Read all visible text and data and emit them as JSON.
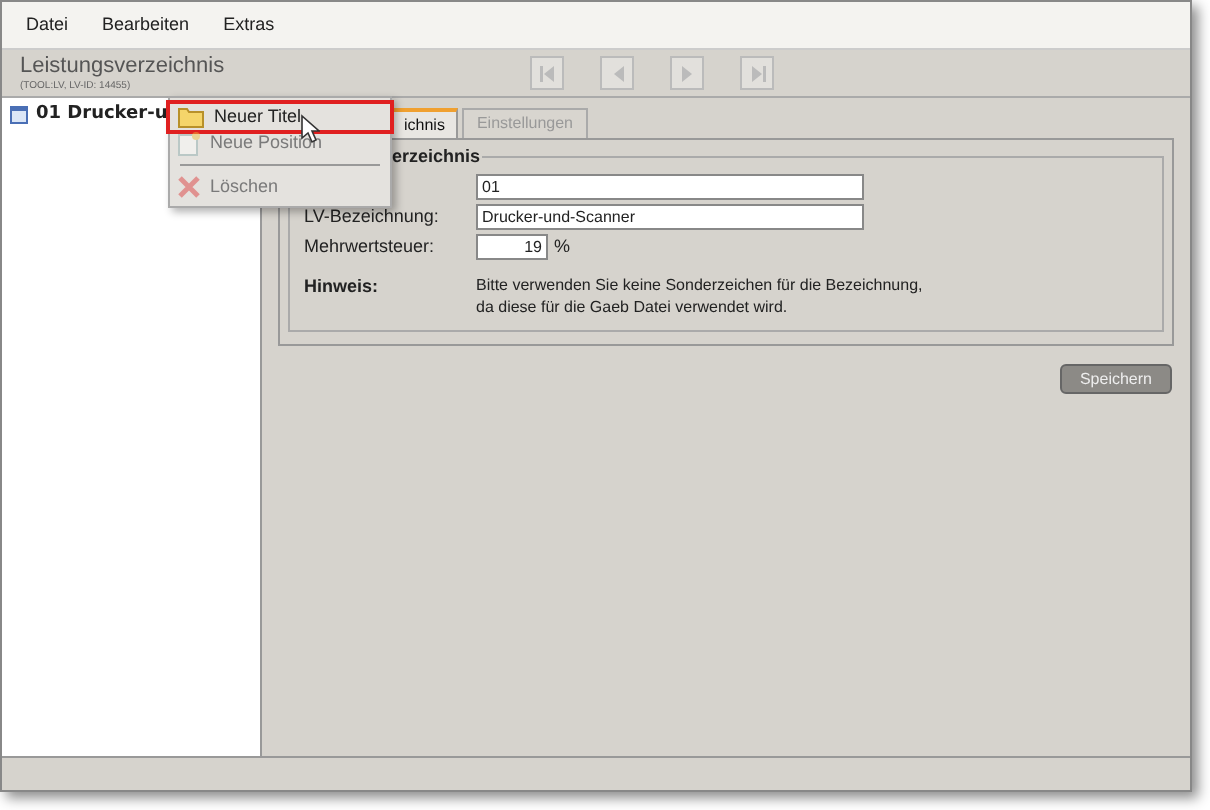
{
  "menu_bar": [
    "Datei",
    "Bearbeiten",
    "Extras"
  ],
  "header": {
    "title": "Leistungsverzeichnis",
    "subtitle": "(TOOL:LV, LV-ID: 14455)"
  },
  "nav_buttons": [
    {
      "kind": "first",
      "disabled": true
    },
    {
      "kind": "prev",
      "disabled": true
    },
    {
      "kind": "next",
      "disabled": true
    },
    {
      "kind": "last",
      "disabled": true
    }
  ],
  "tree": [
    {
      "label": "01 Drucker-u"
    }
  ],
  "context_menu": [
    {
      "kind": "new-title",
      "label": "Neuer Titel",
      "disabled": false,
      "highlighted": true
    },
    {
      "kind": "new-position",
      "label": "Neue Position",
      "disabled": true,
      "highlighted": false
    },
    {
      "kind": "separator"
    },
    {
      "kind": "delete",
      "label": "Löschen",
      "disabled": true,
      "highlighted": false
    }
  ],
  "tabs": [
    {
      "label": "ichnis",
      "selected": true
    },
    {
      "label": "Einstellungen",
      "selected": false
    }
  ],
  "fieldset": {
    "legend": "erzeichnis",
    "fields": [
      {
        "value": "01",
        "kind": "wide"
      },
      {
        "label": "LV-Bezeichnung:",
        "value": "Drucker-und-Scanner",
        "kind": "wide"
      },
      {
        "label": "Mehrwertsteuer:",
        "value": "19",
        "suffix": "%",
        "kind": "short"
      }
    ],
    "hint_label": "Hinweis:",
    "hint_lines": [
      "Bitte verwenden Sie keine Sonderzeichen für die Bezeichnung,",
      "da diese für die Gaeb Datei verwendet wird."
    ]
  },
  "save_button": "Speichern"
}
